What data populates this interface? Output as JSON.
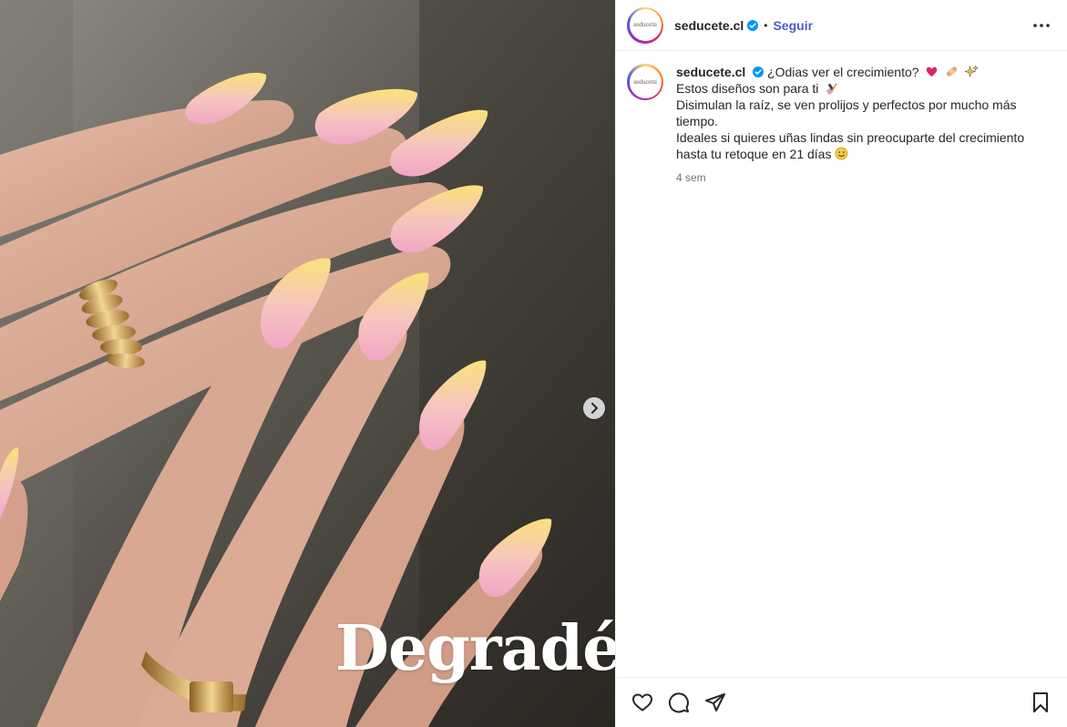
{
  "post": {
    "overlay_text": "Degradé",
    "image_alt": "Manicure with almond nails in pink-to-yellow gradient and gold rings"
  },
  "header": {
    "avatar_logo": "seducete",
    "username": "seducete.cl",
    "separator": "•",
    "follow_label": "Seguir"
  },
  "caption": {
    "username": "seducete.cl",
    "line1": "¿Odias ver el crecimiento?",
    "line2": "Estos diseños son para ti",
    "line3": "Disimulan la raíz, se ven prolijos y perfectos por mucho más tiempo.",
    "line4": "Ideales si quieres uñas lindas sin preocuparte del crecimiento hasta tu retoque en 21 días",
    "timestamp": "4 sem"
  },
  "icons": {
    "verified": "verified-badge-icon",
    "more": "more-options-icon",
    "next": "chevron-right-icon",
    "like": "heart-icon",
    "comment": "comment-icon",
    "share": "paper-plane-icon",
    "save": "bookmark-icon"
  },
  "colors": {
    "accent": "#4f5bd5",
    "verified": "#0095f6",
    "text": "#262626",
    "muted": "#737373"
  }
}
